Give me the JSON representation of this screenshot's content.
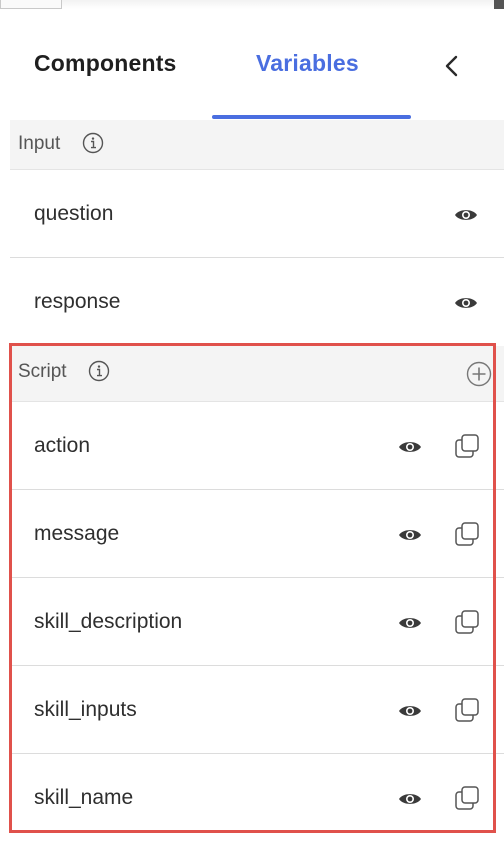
{
  "tabs": {
    "components_label": "Components",
    "variables_label": "Variables",
    "active": "Variables",
    "collapse_icon": "chevron-left-icon"
  },
  "input_section": {
    "title": "Input",
    "info_icon": "info-icon",
    "items": [
      {
        "name": "question",
        "icons": [
          "eye-icon"
        ]
      },
      {
        "name": "response",
        "icons": [
          "eye-icon"
        ]
      }
    ]
  },
  "script_section": {
    "title": "Script",
    "info_icon": "info-icon",
    "add_icon": "plus-circle-icon",
    "items": [
      {
        "name": "action",
        "icons": [
          "eye-icon",
          "copy-icon"
        ]
      },
      {
        "name": "message",
        "icons": [
          "eye-icon",
          "copy-icon"
        ]
      },
      {
        "name": "skill_description",
        "icons": [
          "eye-icon",
          "copy-icon"
        ]
      },
      {
        "name": "skill_inputs",
        "icons": [
          "eye-icon",
          "copy-icon"
        ]
      },
      {
        "name": "skill_name",
        "icons": [
          "eye-icon",
          "copy-icon"
        ]
      }
    ]
  },
  "colors": {
    "accent": "#4a6ee0",
    "highlight_border": "#e0514b",
    "section_background": "#f4f4f4"
  }
}
